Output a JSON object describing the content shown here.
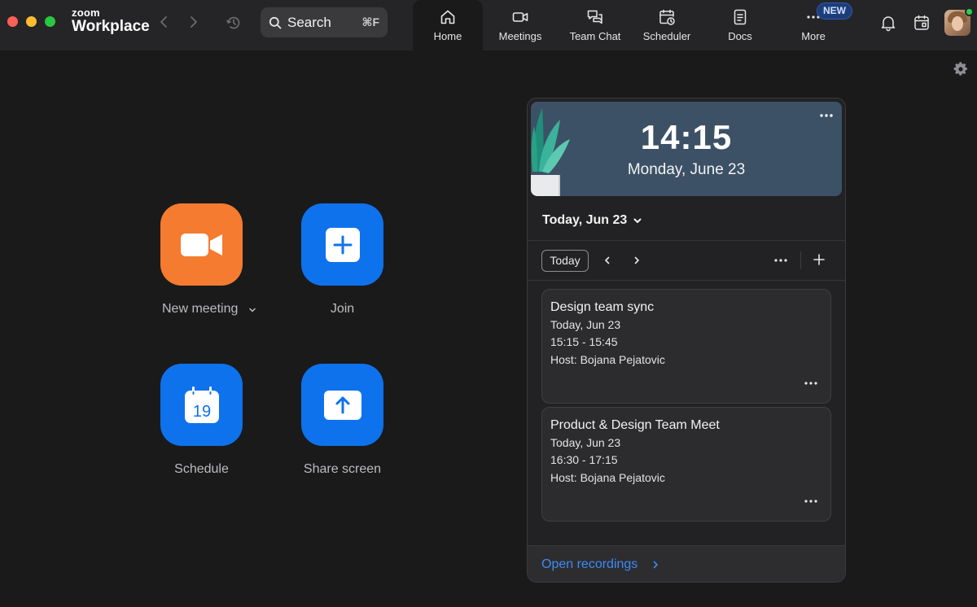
{
  "app": {
    "logo_line1": "zoom",
    "logo_line2": "Workplace"
  },
  "search": {
    "label": "Search",
    "shortcut": "⌘F"
  },
  "tabs": [
    {
      "label": "Home",
      "icon": "home-icon",
      "active": true
    },
    {
      "label": "Meetings",
      "icon": "video-icon"
    },
    {
      "label": "Team Chat",
      "icon": "chat-icon"
    },
    {
      "label": "Scheduler",
      "icon": "scheduler-icon"
    },
    {
      "label": "Docs",
      "icon": "docs-icon"
    },
    {
      "label": "More",
      "icon": "more-icon",
      "badge": "NEW"
    }
  ],
  "actions": {
    "new_meeting": "New meeting",
    "join": "Join",
    "schedule": "Schedule",
    "schedule_day": "19",
    "share_screen": "Share screen"
  },
  "calendar": {
    "clock": "14:15",
    "date_long": "Monday, June 23",
    "day_selector": "Today, Jun 23",
    "today_button": "Today",
    "events": [
      {
        "title": "Design team sync",
        "date": "Today, Jun 23",
        "time": "15:15 - 15:45",
        "host": "Host: Bojana Pejatovic"
      },
      {
        "title": "Product & Design Team Meet",
        "date": "Today, Jun 23",
        "time": "16:30 - 17:15",
        "host": "Host: Bojana Pejatovic"
      }
    ],
    "open_recordings": "Open recordings"
  },
  "colors": {
    "accent_blue": "#0e72ed",
    "accent_orange": "#f47b2f",
    "background": "#1a1a1b",
    "topbar": "#252527",
    "online": "#2ad14e"
  }
}
